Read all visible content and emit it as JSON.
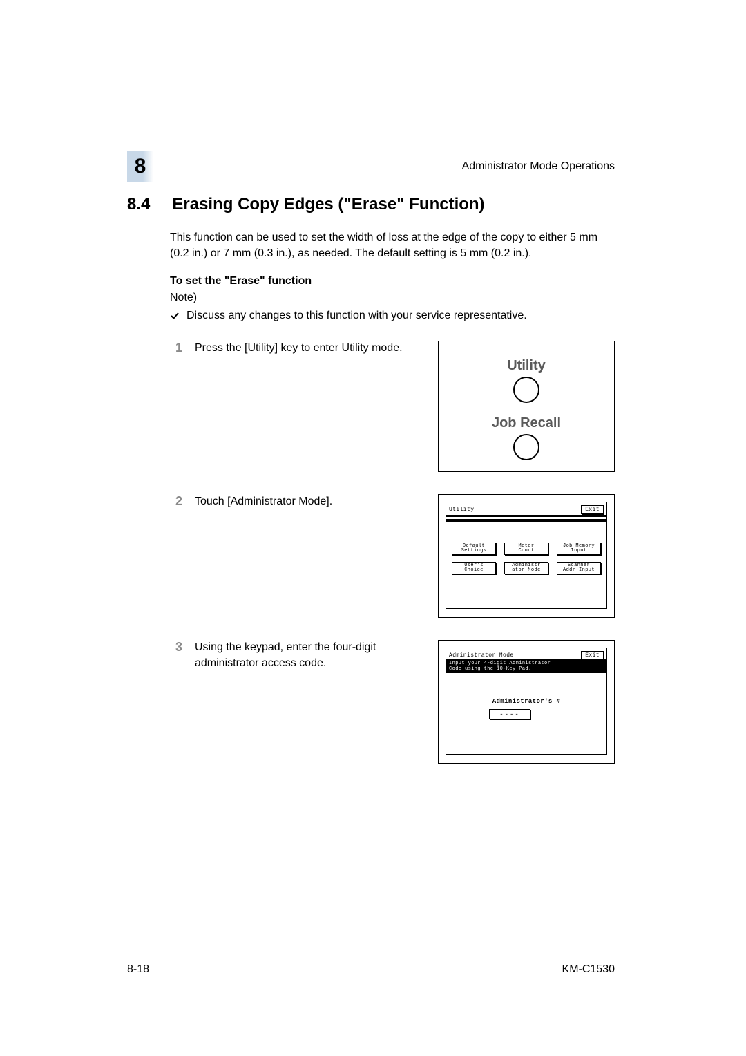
{
  "header": {
    "chapter_number": "8",
    "section": "Administrator Mode Operations"
  },
  "section": {
    "number": "8.4",
    "title": "Erasing Copy Edges (\"Erase\" Function)"
  },
  "intro_paragraph": "This function can be used to set the width of loss at the edge of the copy to either 5 mm (0.2 in.) or 7 mm (0.3 in.), as needed. The default setting is 5 mm (0.2 in.).",
  "sub_heading": "To set the \"Erase\" function",
  "note_label": "Note)",
  "bullet_text": "Discuss any changes to this function with your service representative.",
  "steps": [
    {
      "num": "1",
      "text": "Press the [Utility] key to enter Utility mode."
    },
    {
      "num": "2",
      "text": "Touch [Administrator Mode]."
    },
    {
      "num": "3",
      "text": "Using the keypad, enter the four-digit administrator access code."
    }
  ],
  "fig1": {
    "utility_label": "Utility",
    "job_recall_label": "Job Recall"
  },
  "fig2": {
    "title": "Utility",
    "exit": "Exit",
    "buttons_row1": [
      {
        "line1": "Default",
        "line2": "Settings"
      },
      {
        "line1": "Meter",
        "line2": "Count"
      },
      {
        "line1": "Job Memory",
        "line2": "Input"
      }
    ],
    "buttons_row2": [
      {
        "line1": "User's",
        "line2": "Choice"
      },
      {
        "line1": "Administr",
        "line2": "ator Mode"
      },
      {
        "line1": "Scanner",
        "line2": "Addr.Input"
      }
    ]
  },
  "fig3": {
    "title": "Administrator Mode",
    "exit": "Exit",
    "message_line1": "Input your 4-digit Administrator",
    "message_line2": "Code using the 10-Key Pad.",
    "field_label": "Administrator's #",
    "entry_value": "----"
  },
  "footer": {
    "page_num": "8-18",
    "model": "KM-C1530"
  }
}
